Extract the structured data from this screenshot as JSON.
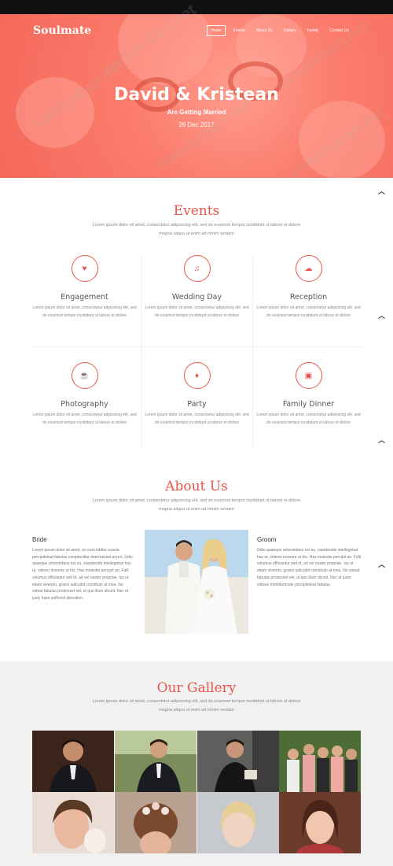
{
  "brand": "Soulmate",
  "nav": [
    "Home",
    "Events",
    "About Us",
    "Gallery",
    "Family",
    "Contact Us"
  ],
  "hero": {
    "title": "David & Kristean",
    "subtitle": "Are Getting Married",
    "date": "26 Dec 2017"
  },
  "watermark": "webmoban.net",
  "events": {
    "title": "Events",
    "desc": "Lorem ipsum dolor sit amet, consectetur adipisicing elit, sed do eiusmod tempor incididunt ut labore et dolore magna aliqua ut enim ad minim veniam",
    "items": [
      {
        "name": "Engagement",
        "icon": "heart-icon",
        "text": "Lorem ipsum dolor sit amet, consectetur adipisicing elit, sed do eiusmod tempor incididunt ut labore et dolore"
      },
      {
        "name": "Wedding Day",
        "icon": "music-icon",
        "text": "Lorem ipsum dolor sit amet, consectetur adipisicing elit, sed do eiusmod tempor incididunt ut labore et dolore"
      },
      {
        "name": "Reception",
        "icon": "cloud-icon",
        "text": "Lorem ipsum dolor sit amet, consectetur adipisicing elit, sed do eiusmod tempor incididunt ut labore et dolore"
      },
      {
        "name": "Photography",
        "icon": "cup-icon",
        "text": "Lorem ipsum dolor sit amet, consectetur adipisicing elit, sed do eiusmod tempor incididunt ut labore et dolore"
      },
      {
        "name": "Party",
        "icon": "glass-icon",
        "text": "Lorem ipsum dolor sit amet, consectetur adipisicing elit, sed do eiusmod tempor incididunt ut labore et dolore"
      },
      {
        "name": "Family Dinner",
        "icon": "gift-icon",
        "text": "Lorem ipsum dolor sit amet, consectetur adipisicing elit, sed do eiusmod tempor incididunt ut labore et dolore"
      }
    ]
  },
  "about": {
    "title": "About Us",
    "desc": "Lorem ipsum dolor sit amet, consectetur adipisicing elit, sed do eiusmod tempor incididunt ut labore et dolore magna aliqua ut enim ad minim veniam",
    "bride": {
      "heading": "Bride",
      "text": "Lorem ipsum dolor sit amet, eu eum labitur scaola percipitoleat fabulas complectitur deterruisset at pro. Odio quaeque reformidans est eu, expetendis intellegebat has ut, viderer invenire ut his. Has molestie percipit an. Falli volumus efficiantur sed id, ad vel noster propriae. Ius ut etiam vivendo, graeci iudicabit constituto at mea. No soleat fabulas prodesset vel, ut quo illum dicunt. Nec et justy have suffered alteration."
    },
    "groom": {
      "heading": "Groom",
      "text": "Odio quaeque reformidans est eu, expetendis intellegebat has ut, viderer invenire ut his. Has molestie percipit an. Falli volumus efficiantur sed id, ad vel noster propriae. Ius ut etiam vivendo, graeci iudicabit constituto at mea. No soleat fabulas prodesset vel, ut quo illum dicunt. Nec et justo vidisse mentitumoste percipitoleat fabulas."
    }
  },
  "gallery": {
    "title": "Our Gallery",
    "desc": "Lorem ipsum dolor sit amet, consectetur adipisicing elit, sed do eiusmod tempor incididunt ut labore et dolore magna aliqua ut enim ad minim veniam"
  },
  "colors": {
    "accent": "#e8564a",
    "hero": "#f5685a",
    "gallery_bg": "#f1f1f1"
  }
}
